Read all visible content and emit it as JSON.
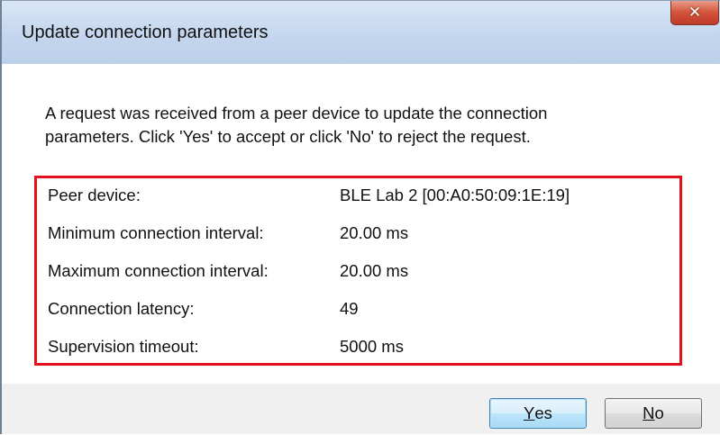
{
  "window": {
    "title": "Update connection parameters",
    "close_glyph": "✕"
  },
  "message": {
    "line1": "A request was received from a peer device to update the connection",
    "line2": "parameters. Click 'Yes' to accept or click 'No' to reject the request."
  },
  "params": [
    {
      "label": "Peer device:",
      "value": "BLE Lab 2 [00:A0:50:09:1E:19]"
    },
    {
      "label": "Minimum connection interval:",
      "value": "20.00 ms"
    },
    {
      "label": "Maximum connection interval:",
      "value": "20.00 ms"
    },
    {
      "label": "Connection latency:",
      "value": "49"
    },
    {
      "label": "Supervision timeout:",
      "value": "5000 ms"
    }
  ],
  "buttons": {
    "yes": {
      "mnemonic": "Y",
      "rest": "es"
    },
    "no": {
      "mnemonic": "N",
      "rest": "o"
    }
  },
  "colors": {
    "highlight_border": "#e3101d",
    "close_button": "#c0392b",
    "titlebar": "#c4d6ee"
  }
}
